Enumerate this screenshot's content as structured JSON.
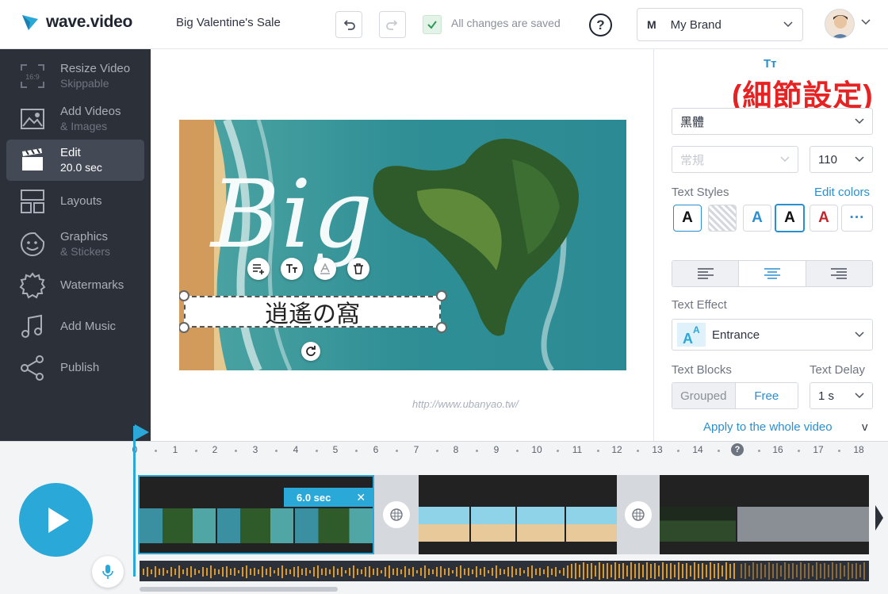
{
  "header": {
    "app_name": "wave.video",
    "project_title": "Big Valentine's Sale",
    "saved_status": "All changes are saved",
    "help_label": "?",
    "brand_initial": "M",
    "brand_name": "My Brand"
  },
  "sidebar": {
    "items": [
      {
        "label": "Resize Video",
        "sub": "Skippable",
        "icon": "resize-icon",
        "active": false
      },
      {
        "label": "Add Videos",
        "sub": "& Images",
        "icon": "image-icon",
        "active": false
      },
      {
        "label": "Edit",
        "sub": "20.0 sec",
        "icon": "clapperboard-icon",
        "active": true
      },
      {
        "label": "Layouts",
        "sub": "",
        "icon": "layout-icon",
        "active": false
      },
      {
        "label": "Graphics",
        "sub": "& Stickers",
        "icon": "sticker-icon",
        "active": false
      },
      {
        "label": "Watermarks",
        "sub": "",
        "icon": "watermark-icon",
        "active": false
      },
      {
        "label": "Add Music",
        "sub": "",
        "icon": "music-icon",
        "active": false
      },
      {
        "label": "Publish",
        "sub": "",
        "icon": "share-icon",
        "active": false
      }
    ],
    "resize_badge": "16:9"
  },
  "canvas": {
    "headline": "Big",
    "selected_text": "逍遙の窩",
    "watermark": "http://www.ubanyao.tw/"
  },
  "panel": {
    "annotation": "(細節設定)",
    "font_icon": "Tт",
    "font_family": "黑體",
    "font_weight": "常規",
    "font_size": "110",
    "text_styles_label": "Text Styles",
    "edit_colors": "Edit colors",
    "style_samples": [
      "A",
      "",
      "A",
      "A",
      "A",
      "···"
    ],
    "text_effect_label": "Text Effect",
    "text_effect_value": "Entrance",
    "text_blocks_label": "Text Blocks",
    "text_delay_label": "Text Delay",
    "blocks_options": [
      "Grouped",
      "Free"
    ],
    "blocks_selected": "Free",
    "delay_value": "1 s",
    "apply_link": "Apply to the whole video",
    "collapse": "v"
  },
  "timeline": {
    "ticks": [
      "0",
      "1",
      "2",
      "3",
      "4",
      "5",
      "6",
      "7",
      "8",
      "9",
      "10",
      "11",
      "12",
      "13",
      "14",
      "15",
      "16",
      "17",
      "18"
    ],
    "marker_label": "?",
    "marker_at": "15",
    "clip_duration": "6.0 sec"
  },
  "colors": {
    "accent": "#2aa8d8",
    "link": "#2b8fcf",
    "sidebar_bg": "#2c3038",
    "annotation": "#e62222"
  }
}
